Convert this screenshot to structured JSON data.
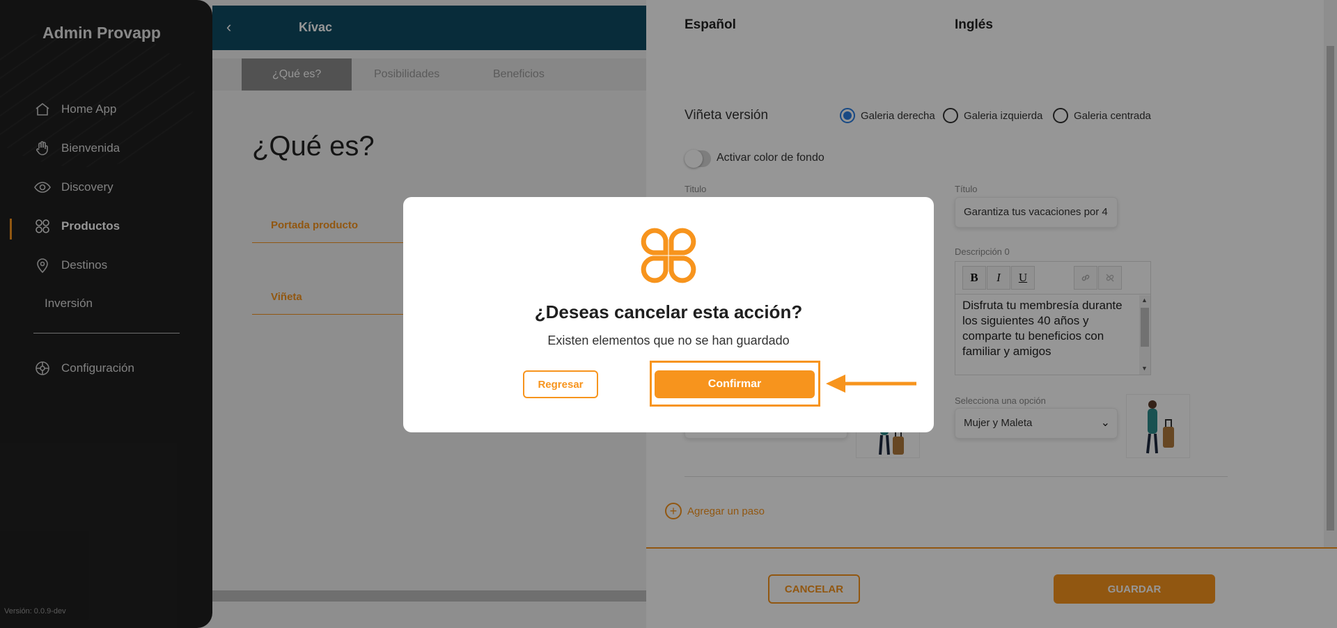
{
  "sidebar": {
    "brand": "Admin Provapp",
    "items": [
      {
        "label": "Home App"
      },
      {
        "label": "Bienvenida"
      },
      {
        "label": "Discovery"
      },
      {
        "label": "Productos"
      },
      {
        "label": "Destinos"
      },
      {
        "label": "Inversión"
      },
      {
        "label": "Configuración"
      }
    ],
    "active": "Productos",
    "version": "Versión: 0.0.9-dev"
  },
  "topbar": {
    "back_icon": "chevron-left-icon",
    "title": "Kívac"
  },
  "tabs": [
    {
      "label": "¿Qué es?"
    },
    {
      "label": "Posibilidades"
    },
    {
      "label": "Beneficios"
    }
  ],
  "main": {
    "heading": "¿Qué es?",
    "sections": [
      {
        "label": "Portada producto"
      },
      {
        "label": "Viñeta"
      }
    ]
  },
  "drawer": {
    "lang_es": "Español",
    "lang_en": "Inglés",
    "vineta_label": "Viñeta versión",
    "radios": [
      {
        "label": "Galeria derecha",
        "checked": true
      },
      {
        "label": "Galeria izquierda",
        "checked": false
      },
      {
        "label": "Galeria centrada",
        "checked": false
      }
    ],
    "toggle_label": "Activar color de fondo",
    "toggle_on": false,
    "title_label_es": "Titulo",
    "title_label_en": "Título",
    "title_value_en": "Garantiza tus vacaciones por 4",
    "desc_label": "Descripción 0",
    "toolbar": {
      "bold": "B",
      "italic": "I",
      "underline": "U"
    },
    "desc_text": "Disfruta tu membresía durante los siguientes 40 años y comparte tu beneficios con familiar y amigos",
    "select_label": "Selecciona una opción",
    "select_value": "Mujer y Maleta",
    "add_step": "Agregar un paso",
    "cancel_label": "CANCELAR",
    "save_label": "GUARDAR"
  },
  "modal": {
    "title": "¿Deseas cancelar esta acción?",
    "subtitle": "Existen elementos que no se han guardado",
    "back_label": "Regresar",
    "confirm_label": "Confirmar"
  },
  "colors": {
    "accent": "#f7941d",
    "topbar": "#0f4c63",
    "sidebar": "#202020",
    "radio_selected": "#2a7de1"
  }
}
